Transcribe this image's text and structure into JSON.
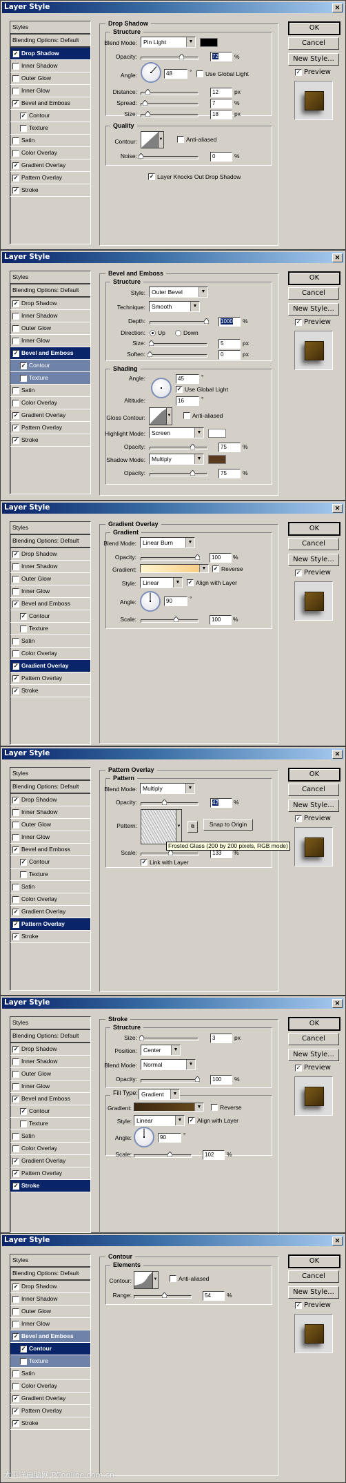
{
  "dialog_title": "Layer Style",
  "close_glyph": "✕",
  "buttons": {
    "ok": "OK",
    "cancel": "Cancel",
    "new_style": "New Style...",
    "preview": "Preview"
  },
  "style_list": {
    "header": "Styles",
    "blending": "Blending Options: Default",
    "items": [
      "Drop Shadow",
      "Inner Shadow",
      "Outer Glow",
      "Inner Glow",
      "Bevel and Emboss",
      "Contour",
      "Texture",
      "Satin",
      "Color Overlay",
      "Gradient Overlay",
      "Pattern Overlay",
      "Stroke"
    ],
    "checked": [
      true,
      false,
      false,
      false,
      true,
      true,
      false,
      false,
      false,
      true,
      true,
      true
    ]
  },
  "check_glyph": "✓",
  "dialogs": [
    {
      "selected": "Drop Shadow",
      "section_title": "Drop Shadow",
      "structure_title": "Structure",
      "blend_mode_label": "Blend Mode:",
      "blend_mode": "Pin Light",
      "color": "#000000",
      "opacity_label": "Opacity:",
      "opacity": "72",
      "opacity_unit": "%",
      "angle_label": "Angle:",
      "angle": "48",
      "angle_unit": "°",
      "global_light_label": "Use Global Light",
      "global_light": false,
      "distance_label": "Distance:",
      "distance": "12",
      "distance_unit": "px",
      "spread_label": "Spread:",
      "spread": "7",
      "spread_unit": "%",
      "size_label": "Size:",
      "size": "18",
      "size_unit": "px",
      "quality_title": "Quality",
      "contour_label": "Contour:",
      "anti_aliased_label": "Anti-aliased",
      "anti_aliased": false,
      "noise_label": "Noise:",
      "noise": "0",
      "noise_unit": "%",
      "knockout_label": "Layer Knocks Out Drop Shadow",
      "knockout": true,
      "slider_fraction": {
        "opacity": 0.72,
        "distance": 0.12,
        "spread": 0.07,
        "size": 0.12,
        "noise": 0.0
      }
    },
    {
      "selected": "Bevel and Emboss",
      "section_title": "Bevel and Emboss",
      "structure_title": "Structure",
      "style_label": "Style:",
      "style": "Outer Bevel",
      "technique_label": "Technique:",
      "technique": "Smooth",
      "depth_label": "Depth:",
      "depth": "1000",
      "depth_unit": "%",
      "direction_label": "Direction:",
      "dir_up": "Up",
      "dir_down": "Down",
      "direction": "Up",
      "size_label": "Size:",
      "size": "5",
      "size_unit": "px",
      "soften_label": "Soften:",
      "soften": "0",
      "soften_unit": "px",
      "shading_title": "Shading",
      "angle_label": "Angle:",
      "angle": "45",
      "angle_unit": "°",
      "global_light_label": "Use Global Light",
      "global_light": true,
      "altitude_label": "Altitude:",
      "altitude": "16",
      "altitude_unit": "°",
      "gloss_label": "Gloss Contour:",
      "anti_aliased_label": "Anti-aliased",
      "anti_aliased": false,
      "highlight_label": "Highlight Mode:",
      "highlight_mode": "Screen",
      "highlight_color": "#ffffff",
      "opacity_label": "Opacity:",
      "highlight_opacity": "75",
      "opacity_unit": "%",
      "shadow_label": "Shadow Mode:",
      "shadow_mode": "Multiply",
      "shadow_color": "#5a3a1e",
      "shadow_opacity": "75",
      "slider_fraction": {
        "depth": 1.0,
        "size": 0.03,
        "soften": 0.0,
        "highlight_opacity": 0.75,
        "shadow_opacity": 0.75
      }
    },
    {
      "selected": "Gradient Overlay",
      "section_title": "Gradient Overlay",
      "group_title": "Gradient",
      "blend_mode_label": "Blend Mode:",
      "blend_mode": "Linear Burn",
      "opacity_label": "Opacity:",
      "opacity": "100",
      "opacity_unit": "%",
      "gradient_label": "Gradient:",
      "gradient_from": "#fff5d0",
      "gradient_to": "#f7c97a",
      "reverse_label": "Reverse",
      "reverse": true,
      "style_label": "Style:",
      "style": "Linear",
      "align_label": "Align with Layer",
      "align": true,
      "angle_label": "Angle:",
      "angle": "90",
      "angle_unit": "°",
      "scale_label": "Scale:",
      "scale": "100",
      "scale_unit": "%",
      "slider_fraction": {
        "opacity": 1.0,
        "scale": 0.62
      }
    },
    {
      "selected": "Pattern Overlay",
      "section_title": "Pattern Overlay",
      "group_title": "Pattern",
      "blend_mode_label": "Blend Mode:",
      "blend_mode": "Multiply",
      "opacity_label": "Opacity:",
      "opacity": "42",
      "opacity_unit": "%",
      "pattern_label": "Pattern:",
      "snap_label": "Snap to Origin",
      "tooltip": "Frosted Glass (200 by 200 pixels, RGB mode)",
      "scale_label": "Scale:",
      "scale": "133",
      "scale_unit": "%",
      "link_label": "Link with Layer",
      "link": true,
      "slider_fraction": {
        "opacity": 0.42,
        "scale": 0.52
      }
    },
    {
      "selected": "Stroke",
      "section_title": "Stroke",
      "structure_title": "Structure",
      "size_label": "Size:",
      "size": "3",
      "size_unit": "px",
      "position_label": "Position:",
      "position": "Center",
      "blend_mode_label": "Blend Mode:",
      "blend_mode": "Normal",
      "opacity_label": "Opacity:",
      "opacity": "100",
      "opacity_unit": "%",
      "fill_type_label": "Fill Type:",
      "fill_type": "Gradient",
      "gradient_label": "Gradient:",
      "gradient_from": "#3a2510",
      "gradient_to": "#6b4e1e",
      "reverse_label": "Reverse",
      "reverse": false,
      "style_label": "Style:",
      "style": "Linear",
      "align_label": "Align with Layer",
      "align": true,
      "angle_label": "Angle:",
      "angle": "90",
      "angle_unit": "°",
      "scale_label": "Scale:",
      "scale": "102",
      "scale_unit": "%",
      "slider_fraction": {
        "size": 0.01,
        "opacity": 1.0,
        "scale": 0.64
      }
    },
    {
      "selected": "Contour",
      "section_title": "Contour",
      "group_title": "Elements",
      "contour_label": "Contour:",
      "anti_aliased_label": "Anti-aliased",
      "anti_aliased": false,
      "range_label": "Range:",
      "range": "54",
      "range_unit": "%",
      "slider_fraction": {
        "range": 0.54
      }
    }
  ],
  "watermark": "太平洋电脑网 PConline.com.cn"
}
